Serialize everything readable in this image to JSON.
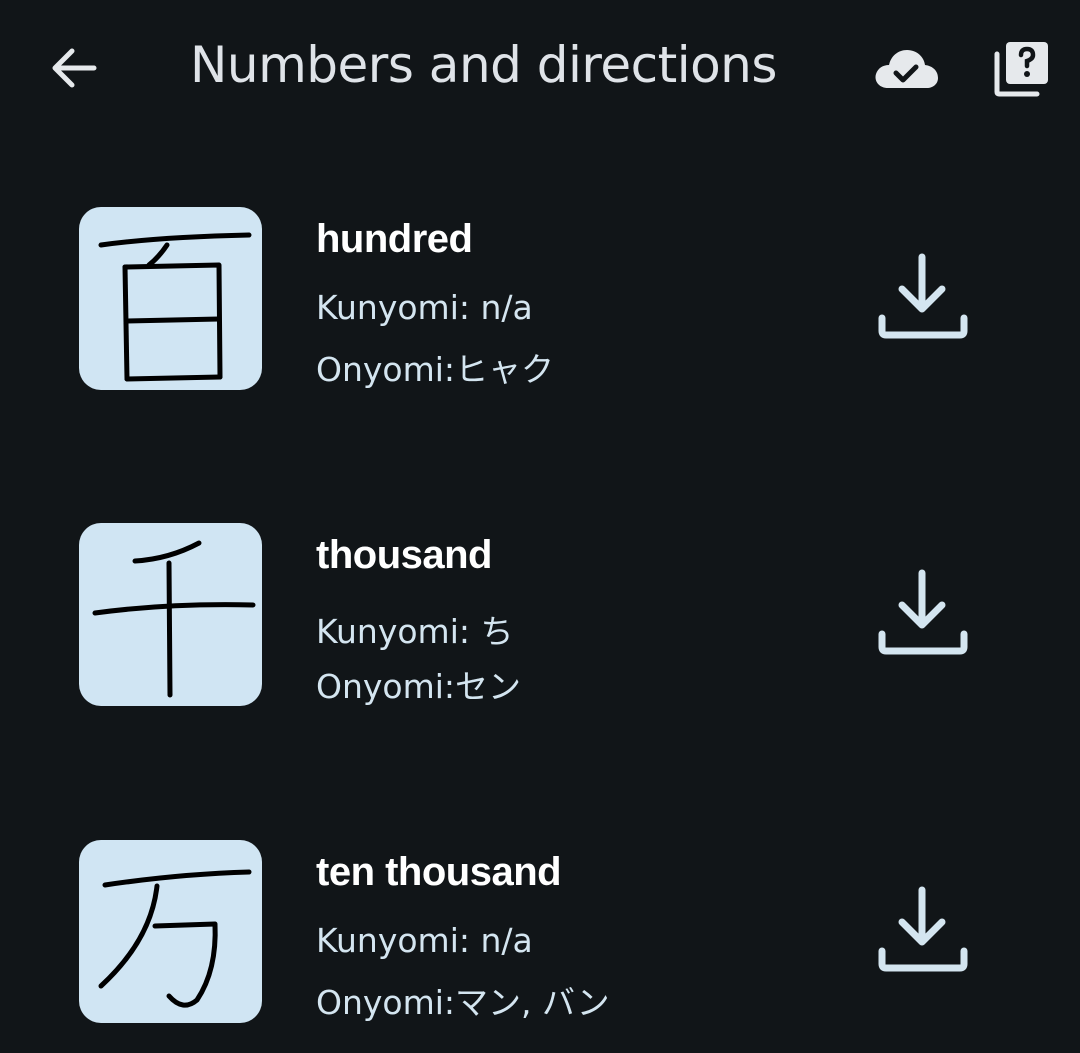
{
  "app_bar": {
    "title": "Numbers and directions",
    "back_icon": "arrow-back-icon",
    "cloud_icon": "cloud-done-icon",
    "library_icon": "quiz-library-icon"
  },
  "kanji_list": [
    {
      "kanji": "百",
      "meaning": "hundred",
      "kunyomi": "Kunyomi: n/a",
      "onyomi": "Onyomi:ヒャク",
      "action_icon": "download-icon"
    },
    {
      "kanji": "千",
      "meaning": "thousand",
      "kunyomi": "Kunyomi: ち",
      "onyomi": "Onyomi:セン",
      "action_icon": "download-icon"
    },
    {
      "kanji": "万",
      "meaning": "ten thousand",
      "kunyomi": "Kunyomi: n/a",
      "onyomi": "Onyomi:マン, バン",
      "action_icon": "download-icon"
    }
  ],
  "colors": {
    "background": "#111518",
    "title": "#dfe3e8",
    "thumb_background": "#d0e5f3",
    "reading_text": "#d4e5f0",
    "icon": "#d4e5f0"
  }
}
